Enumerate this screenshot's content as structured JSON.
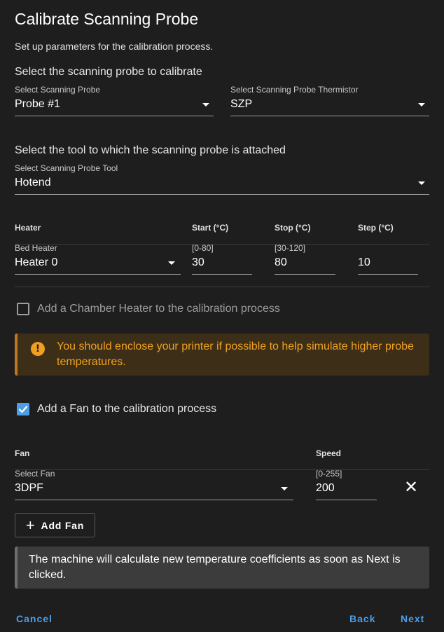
{
  "dialog": {
    "title": "Calibrate Scanning Probe",
    "subtitle": "Set up parameters for the calibration process."
  },
  "probe_section": {
    "heading": "Select the scanning probe to calibrate",
    "probe": {
      "label": "Select Scanning Probe",
      "value": "Probe #1"
    },
    "thermistor": {
      "label": "Select Scanning Probe Thermistor",
      "value": "SZP"
    }
  },
  "tool_section": {
    "heading": "Select the tool to which the scanning probe is attached",
    "tool": {
      "label": "Select Scanning Probe Tool",
      "value": "Hotend"
    }
  },
  "heater_table": {
    "headers": {
      "heater": "Heater",
      "start": "Start (°C)",
      "stop": "Stop (°C)",
      "step": "Step (°C)"
    },
    "row": {
      "heater_label": "Bed Heater",
      "heater_value": "Heater 0",
      "start_hint": "[0-80]",
      "start_value": "30",
      "stop_hint": "[30-120]",
      "stop_value": "80",
      "step_value": "10"
    }
  },
  "chamber_checkbox": {
    "label": "Add a Chamber Heater to the calibration process",
    "checked": false
  },
  "warning": {
    "icon": "exclamation-circle-icon",
    "text": "You should enclose your printer if possible to help simulate higher probe temperatures."
  },
  "fan_checkbox": {
    "label": "Add a Fan to the calibration process",
    "checked": true
  },
  "fan_table": {
    "headers": {
      "fan": "Fan",
      "speed": "Speed"
    },
    "row": {
      "fan_label": "Select Fan",
      "fan_value": "3DPF",
      "speed_hint": "[0-255]",
      "speed_value": "200"
    }
  },
  "add_fan_button": {
    "label": "Add Fan",
    "icon": "plus-icon"
  },
  "info": {
    "text": "The machine will calculate new temperature coefficients as soon as Next is clicked."
  },
  "actions": {
    "cancel": "Cancel",
    "back": "Back",
    "next": "Next"
  },
  "colors": {
    "accent": "#4d9ee8",
    "warning": "#f0a020",
    "background": "#1e1e1e"
  }
}
